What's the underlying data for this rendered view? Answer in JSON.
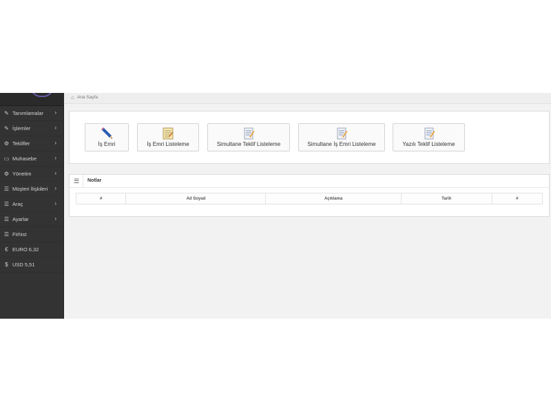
{
  "breadcrumb": {
    "home_icon": "home-icon",
    "label": "Ana Sayfa"
  },
  "sidebar": {
    "items": [
      {
        "label": "Tanımlamalar",
        "icon": "pencil-icon",
        "has_submenu": true
      },
      {
        "label": "İşlemler",
        "icon": "pencil-icon",
        "has_submenu": true
      },
      {
        "label": "Teklifler",
        "icon": "gears-icon",
        "has_submenu": true
      },
      {
        "label": "Muhasebe",
        "icon": "money-icon",
        "has_submenu": true
      },
      {
        "label": "Yönetim",
        "icon": "gears-icon",
        "has_submenu": true
      },
      {
        "label": "Müşteri İlişkileri",
        "icon": "list-icon",
        "has_submenu": true
      },
      {
        "label": "Araç",
        "icon": "list-icon",
        "has_submenu": true
      },
      {
        "label": "Ayarlar",
        "icon": "list-icon",
        "has_submenu": true
      },
      {
        "label": "Firhist",
        "icon": "list-icon",
        "has_submenu": false
      },
      {
        "label": "EURO 6,32",
        "icon": "euro-icon",
        "has_submenu": false
      },
      {
        "label": "USD 5,51",
        "icon": "dollar-icon",
        "has_submenu": false
      }
    ]
  },
  "shortcuts": [
    {
      "label": "İş Emri",
      "icon": "pencil-icon"
    },
    {
      "label": "İş Emri Listeleme",
      "icon": "notepad-icon"
    },
    {
      "label": "Simultane Teklif Listeleme",
      "icon": "document-edit-icon"
    },
    {
      "label": "Simultane İş Emri Listeleme",
      "icon": "document-edit-icon"
    },
    {
      "label": "Yazılı Teklif Listeleme",
      "icon": "document-edit-icon"
    }
  ],
  "notes": {
    "title": "Notlar",
    "columns": [
      "#",
      "Ad Soyad",
      "Açıklama",
      "Tarih",
      "#"
    ]
  },
  "colors": {
    "sidebar_bg": "#333333",
    "content_bg": "#f2f2f2",
    "pencil_blue": "#2f5fb3"
  }
}
